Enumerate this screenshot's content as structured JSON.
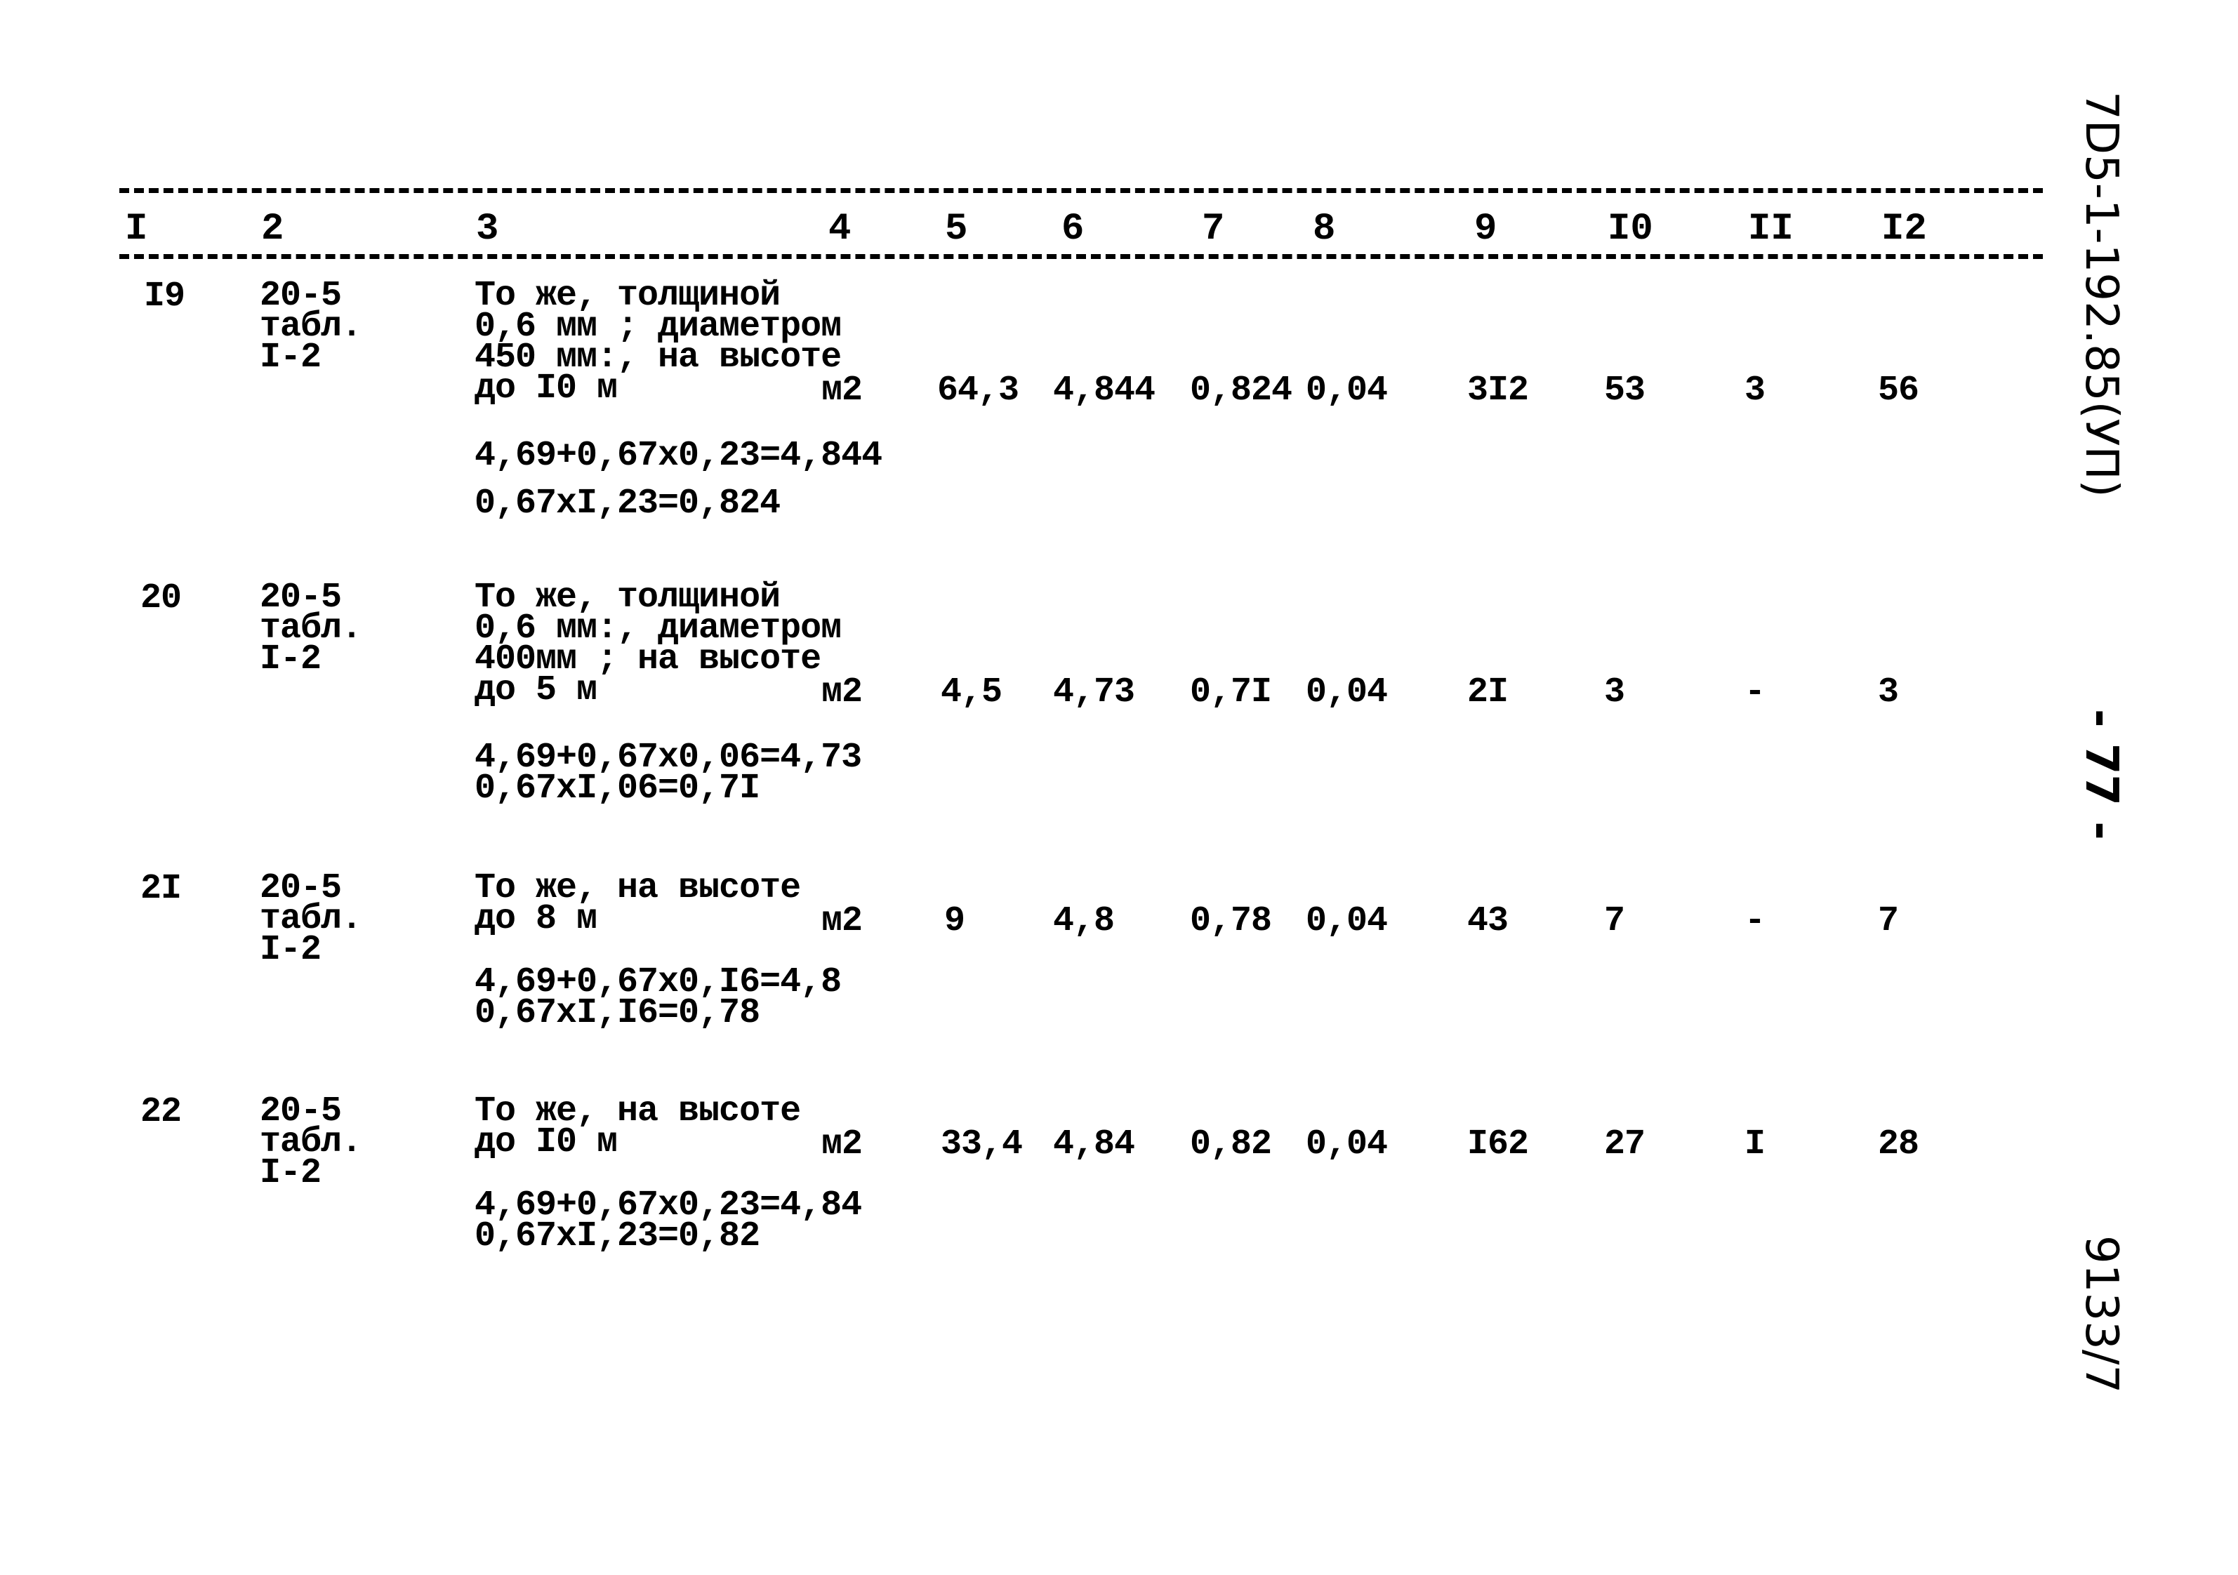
{
  "document": {
    "side_code": "7D5-1-192.85(УП)",
    "page_number": "- 77 -",
    "archive_number": "9133/7"
  },
  "table": {
    "columns": [
      "I",
      "2",
      "3",
      "4",
      "5",
      "6",
      "7",
      "8",
      "9",
      "I0",
      "II",
      "I2"
    ],
    "rows": [
      {
        "no": "I9",
        "ref": [
          "20-5",
          "табл.",
          "I-2"
        ],
        "desc": [
          "То же, толщиной",
          "0,6 мм ; диаметром",
          "450 мм:, на высоте",
          "до I0 м"
        ],
        "unit": "м2",
        "c5": "64,3",
        "c6": "4,844",
        "c7": "0,824",
        "c8": "0,04",
        "c9": "3I2",
        "c10": "53",
        "c11": "3",
        "c12": "56",
        "calc": [
          "4,69+0,67x0,23=4,844",
          "0,67xI,23=0,824"
        ]
      },
      {
        "no": "20",
        "ref": [
          "20-5",
          "табл.",
          "I-2"
        ],
        "desc": [
          "То же, толщиной",
          "0,6 мм:, диаметром",
          "400мм ; на высоте",
          "до 5 м"
        ],
        "unit": "м2",
        "c5": "4,5",
        "c6": "4,73",
        "c7": "0,7I",
        "c8": "0,04",
        "c9": "2I",
        "c10": "3",
        "c11": "-",
        "c12": "3",
        "calc": [
          "4,69+0,67x0,06=4,73",
          "0,67xI,06=0,7I"
        ]
      },
      {
        "no": "2I",
        "ref": [
          "20-5",
          "табл.",
          "I-2"
        ],
        "desc": [
          "То же, на высоте",
          "до 8 м"
        ],
        "unit": "м2",
        "c5": "9",
        "c6": "4,8",
        "c7": "0,78",
        "c8": "0,04",
        "c9": "43",
        "c10": "7",
        "c11": "-",
        "c12": "7",
        "calc": [
          "4,69+0,67x0,I6=4,8",
          "0,67xI,I6=0,78"
        ]
      },
      {
        "no": "22",
        "ref": [
          "20-5",
          "табл.",
          "I-2"
        ],
        "desc": [
          "То же, на высоте",
          "до I0 м"
        ],
        "unit": "м2",
        "c5": "33,4",
        "c6": "4,84",
        "c7": "0,82",
        "c8": "0,04",
        "c9": "I62",
        "c10": "27",
        "c11": "I",
        "c12": "28",
        "calc": [
          "4,69+0,67x0,23=4,84",
          "0,67xI,23=0,82"
        ]
      }
    ]
  }
}
